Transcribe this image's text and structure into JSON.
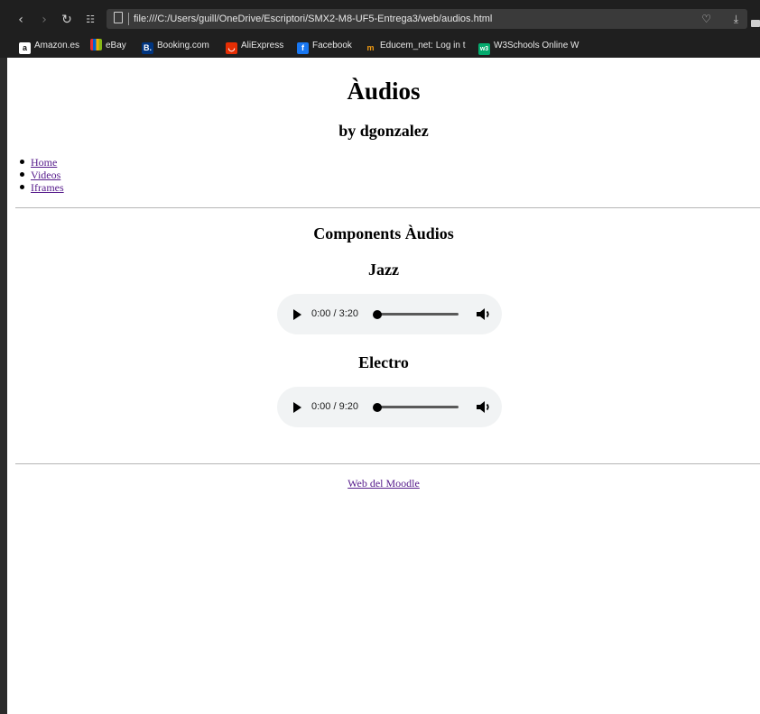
{
  "browser": {
    "url": "file:///C:/Users/guill/OneDrive/Escriptori/SMX2-M8-UF5-Entrega3/web/audios.html",
    "bookmarks": [
      {
        "label": "Amazon.es",
        "icon": "amazon-icon"
      },
      {
        "label": "eBay",
        "icon": "ebay-icon"
      },
      {
        "label": "Booking.com",
        "icon": "booking-icon"
      },
      {
        "label": "AliExpress",
        "icon": "aliexpress-icon"
      },
      {
        "label": "Facebook",
        "icon": "facebook-icon"
      },
      {
        "label": "Educem_net: Log in t",
        "icon": "educem-icon"
      },
      {
        "label": "W3Schools Online W",
        "icon": "w3schools-icon"
      }
    ]
  },
  "page": {
    "title": "Àudios",
    "subtitle": "by dgonzalez",
    "nav": [
      "Home",
      "Videos",
      "Iframes"
    ],
    "section_title": "Components Àudios",
    "tracks": [
      {
        "title": "Jazz",
        "time": "0:00 / 3:20"
      },
      {
        "title": "Electro",
        "time": "0:00 / 9:20"
      }
    ],
    "footer_link": "Web del Moodle"
  },
  "colors": {
    "chrome_bg": "#1f1f1f",
    "visited_link": "#551a8b",
    "player_bg": "#f1f3f4"
  }
}
